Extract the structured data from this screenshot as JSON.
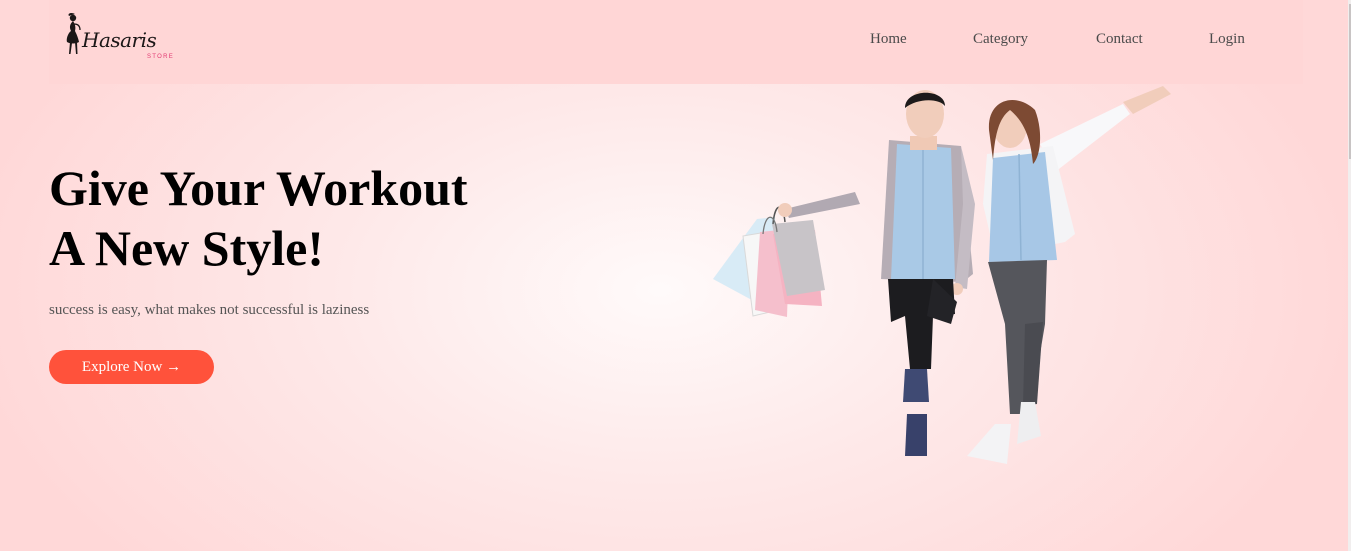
{
  "logo": {
    "wordmark": "Hasaris",
    "subtitle": "STORE",
    "icon": "woman-silhouette-icon"
  },
  "nav": {
    "home": "Home",
    "category": "Category",
    "contact": "Contact",
    "login": "Login"
  },
  "hero": {
    "title_line1": "Give Your Workout",
    "title_line2": "A New Style!",
    "subtitle": "success is easy, what makes not successful is laziness",
    "cta_label": "Explore Now →",
    "image_icon": "couple-with-shopping-bags-illustration"
  },
  "colors": {
    "background": "#ffe4e4",
    "navbar": "#ffd6d6",
    "accent": "#ff523b",
    "logo_accent": "#e23a72"
  }
}
